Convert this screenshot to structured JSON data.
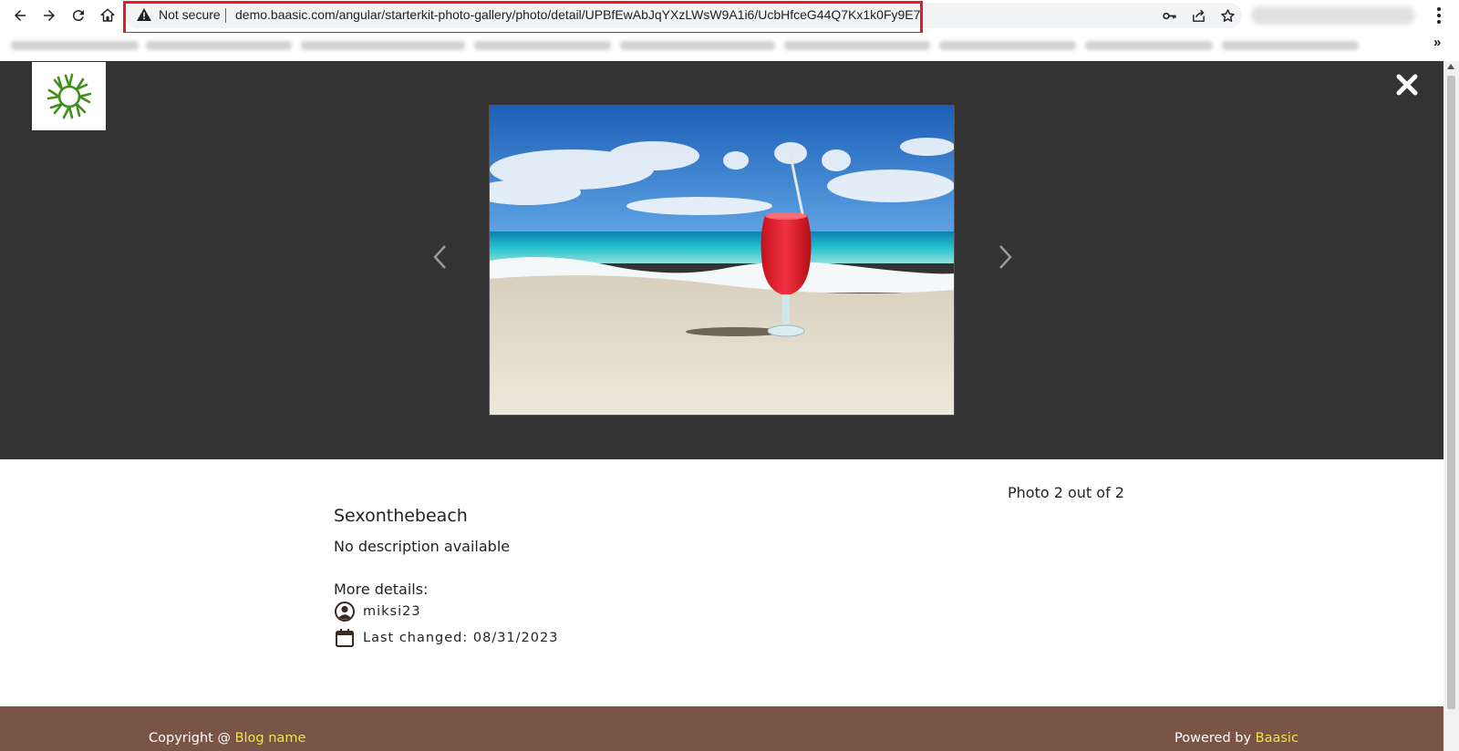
{
  "browser": {
    "security_label": "Not secure",
    "url": "demo.baasic.com/angular/starterkit-photo-gallery/photo/detail/UPBfEwAbJqYXzLWsW9A1i6/UcbHfceG44Q7Kx1k0Fy9E7",
    "bookmarks_more": "»",
    "colors": {
      "highlight_border": "#e21c24"
    }
  },
  "viewer": {
    "background": "#333333",
    "photo_subject": "red cocktail glass with straw on a sandy beach"
  },
  "details": {
    "counter": "Photo 2 out of 2",
    "title": "Sexonthebeach",
    "description": "No description available",
    "more_details_label": "More details:",
    "author": "miksi23",
    "last_changed": "Last changed: 08/31/2023"
  },
  "footer": {
    "copyright_prefix": "Copyright @ ",
    "blog_name": "Blog name",
    "powered_prefix": "Powered by ",
    "powered_link": "Baasic",
    "colors": {
      "background": "#7a5444",
      "link": "#f2e24a"
    }
  }
}
